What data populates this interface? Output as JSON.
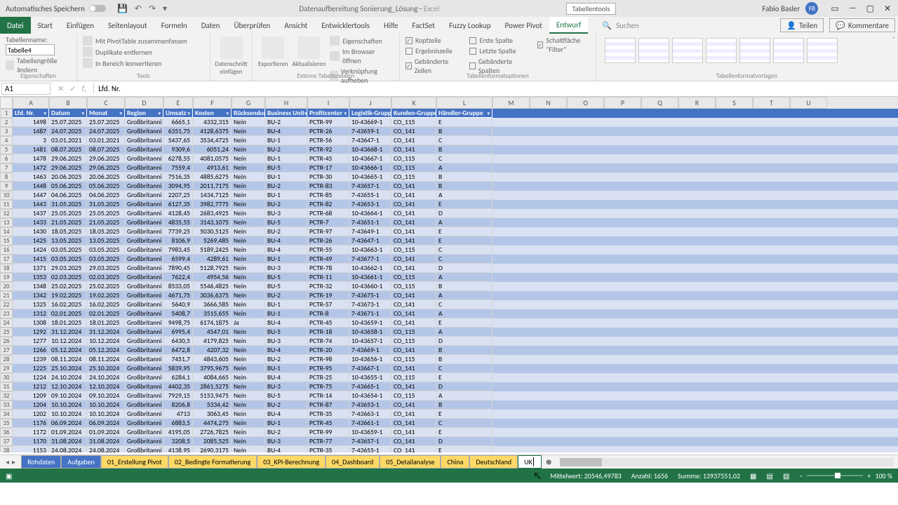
{
  "title": {
    "autosave": "Automatisches Speichern",
    "filename": "Datenaufbereitung Sonierung_Lösung",
    "app": "Excel",
    "tabletools": "Tabellentools",
    "user": "Fabio Basler",
    "initials": "FB"
  },
  "ribbon": {
    "tabs": [
      "Datei",
      "Start",
      "Einfügen",
      "Seitenlayout",
      "Formeln",
      "Daten",
      "Überprüfen",
      "Ansicht",
      "Entwicklertools",
      "Hilfe",
      "FactSet",
      "Fuzzy Lookup",
      "Power Pivot",
      "Entwurf"
    ],
    "search": "Suchen",
    "share": "Teilen",
    "comments": "Kommentare",
    "group_name": {
      "label": "Tabellenname:",
      "value": "Tabelle4",
      "resize": "Tabellengröße ändern",
      "caption": "Eigenschaften"
    },
    "group_tools": {
      "pivot": "Mit PivotTable zusammenfassen",
      "dup": "Duplikate entfernen",
      "range": "In Bereich konvertieren",
      "slicer": "Datenschnitt einfügen",
      "caption": "Tools"
    },
    "group_ext": {
      "export": "Exportieren",
      "refresh": "Aktualisieren",
      "props": "Eigenschaften",
      "browser": "Im Browser öffnen",
      "unlink": "Verknüpfung aufheben",
      "caption": "Externe Tabellendaten"
    },
    "group_opts": {
      "header": "Kopfzeile",
      "total": "Ergebniszeile",
      "banded_rows": "Gebänderte Zeilen",
      "first": "Erste Spalte",
      "last": "Letzte Spalte",
      "banded_cols": "Gebänderte Spalten",
      "filter": "Schaltfläche \"Filter\"",
      "caption": "Tabellenformatoptionen"
    },
    "group_styles": {
      "caption": "Tabellenformatvorlagen"
    }
  },
  "fbar": {
    "namebox": "A1",
    "formula": "Lfd. Nr."
  },
  "columns": [
    "A",
    "B",
    "C",
    "D",
    "E",
    "F",
    "G",
    "H",
    "I",
    "J",
    "K",
    "L",
    "M",
    "N",
    "O",
    "P",
    "Q",
    "R",
    "S",
    "T",
    "U"
  ],
  "headers": [
    "Lfd. Nr.",
    "Datum",
    "Monat",
    "Region",
    "Umsatz",
    "Kosten",
    "Rücksendung",
    "Business Unit",
    "Profitcenter",
    "Logistik-Gruppe",
    "Kunden-Gruppe",
    "Händler-Gruppe"
  ],
  "rows": [
    [
      "1498",
      "25.07.2025",
      "25.07.2025",
      "Großbritanni",
      "6665,1",
      "4332,315",
      "Nein",
      "BU-2",
      "PCTR-99",
      "10-43669-1",
      "CO_115",
      "E"
    ],
    [
      "1487",
      "24.07.2025",
      "24.07.2025",
      "Großbritanni",
      "6351,75",
      "4128,6375",
      "Nein",
      "BU-4",
      "PCTR-26",
      "7-43659-1",
      "CO_141",
      "B"
    ],
    [
      "3",
      "03.01.2021",
      "03.01.2021",
      "Großbritanni",
      "5437,65",
      "3534,4725",
      "Nein",
      "BU-1",
      "PCTR-56",
      "7-43647-1",
      "CO_141",
      "C"
    ],
    [
      "1481",
      "08.07.2025",
      "08.07.2025",
      "Großbritanni",
      "9309,6",
      "6051,24",
      "Nein",
      "BU-2",
      "PCTR-92",
      "10-43668-1",
      "CO_141",
      "B"
    ],
    [
      "1478",
      "29.06.2025",
      "29.06.2025",
      "Großbritanni",
      "6278,55",
      "4081,0575",
      "Nein",
      "BU-1",
      "PCTR-45",
      "10-43667-1",
      "CO_115",
      "C"
    ],
    [
      "1472",
      "29.06.2025",
      "29.06.2025",
      "Großbritanni",
      "7559,4",
      "4913,61",
      "Nein",
      "BU-5",
      "PCTR-17",
      "10-43666-1",
      "CO_115",
      "A"
    ],
    [
      "1463",
      "20.06.2025",
      "20.06.2025",
      "Großbritanni",
      "7516,35",
      "4885,6275",
      "Nein",
      "BU-1",
      "PCTR-30",
      "10-43665-1",
      "CO_115",
      "B"
    ],
    [
      "1448",
      "05.06.2025",
      "05.06.2025",
      "Großbritanni",
      "3094,95",
      "2011,7175",
      "Nein",
      "BU-2",
      "PCTR-83",
      "7-43657-1",
      "CO_141",
      "B"
    ],
    [
      "1447",
      "04.06.2025",
      "04.06.2025",
      "Großbritanni",
      "2207,25",
      "1434,7125",
      "Nein",
      "BU-1",
      "PCTR-85",
      "7-43655-1",
      "CO_141",
      "A"
    ],
    [
      "1443",
      "31.05.2025",
      "31.05.2025",
      "Großbritanni",
      "6127,35",
      "3982,7775",
      "Nein",
      "BU-2",
      "PCTR-82",
      "7-43653-1",
      "CO_141",
      "E"
    ],
    [
      "1437",
      "25.05.2025",
      "25.05.2025",
      "Großbritanni",
      "4128,45",
      "2683,4925",
      "Nein",
      "BU-3",
      "PCTR-68",
      "10-43664-1",
      "CO_141",
      "D"
    ],
    [
      "1433",
      "21.05.2025",
      "21.05.2025",
      "Großbritanni",
      "4835,55",
      "3143,1075",
      "Nein",
      "BU-5",
      "PCTR-7",
      "7-43651-1",
      "CO_141",
      "A"
    ],
    [
      "1430",
      "18.05.2025",
      "18.05.2025",
      "Großbritanni",
      "7739,25",
      "5030,5125",
      "Nein",
      "BU-2",
      "PCTR-97",
      "7-43649-1",
      "CO_141",
      "E"
    ],
    [
      "1425",
      "13.05.2025",
      "13.05.2025",
      "Großbritanni",
      "8106,9",
      "5269,485",
      "Nein",
      "BU-4",
      "PCTR-26",
      "7-43647-1",
      "CO_141",
      "E"
    ],
    [
      "1424",
      "03.05.2025",
      "03.05.2025",
      "Großbritanni",
      "7983,45",
      "5189,2425",
      "Nein",
      "BU-4",
      "PCTR-55",
      "10-43663-1",
      "CO_115",
      "C"
    ],
    [
      "1415",
      "03.05.2025",
      "03.05.2025",
      "Großbritanni",
      "6599,4",
      "4289,61",
      "Nein",
      "BU-1",
      "PCTR-49",
      "7-43677-1",
      "CO_141",
      "C"
    ],
    [
      "1371",
      "29.03.2025",
      "29.03.2025",
      "Großbritanni",
      "7890,45",
      "5128,7925",
      "Nein",
      "BU-3",
      "PCTR-78",
      "10-43662-1",
      "CO_141",
      "D"
    ],
    [
      "1353",
      "02.03.2025",
      "02.03.2025",
      "Großbritanni",
      "7622,4",
      "4954,56",
      "Nein",
      "BU-5",
      "PCTR-11",
      "10-43661-1",
      "CO_115",
      "A"
    ],
    [
      "1348",
      "25.02.2025",
      "25.02.2025",
      "Großbritanni",
      "8533,05",
      "5546,4825",
      "Nein",
      "BU-5",
      "PCTR-32",
      "10-43660-1",
      "CO_115",
      "B"
    ],
    [
      "1342",
      "19.02.2025",
      "19.02.2025",
      "Großbritanni",
      "4671,75",
      "3036,6375",
      "Nein",
      "BU-2",
      "PCTR-19",
      "7-43675-1",
      "CO_141",
      "A"
    ],
    [
      "1325",
      "16.02.2025",
      "16.02.2025",
      "Großbritanni",
      "5640,9",
      "3666,585",
      "Nein",
      "BU-1",
      "PCTR-57",
      "7-43673-1",
      "CO_141",
      "C"
    ],
    [
      "1312",
      "02.01.2025",
      "02.01.2025",
      "Großbritanni",
      "5408,7",
      "3515,655",
      "Nein",
      "BU-1",
      "PCTR-8",
      "7-43671-1",
      "CO_141",
      "A"
    ],
    [
      "1308",
      "18.01.2025",
      "18.01.2025",
      "Großbritanni",
      "9498,75",
      "6174,1875",
      "Ja",
      "BU-4",
      "PCTR-45",
      "10-43659-1",
      "CO_141",
      "E"
    ],
    [
      "1292",
      "31.12.2024",
      "31.12.2024",
      "Großbritanni",
      "6995,4",
      "4547,01",
      "Nein",
      "BU-5",
      "PCTR-18",
      "10-43658-1",
      "CO_115",
      "A"
    ],
    [
      "1277",
      "10.12.2024",
      "10.12.2024",
      "Großbritanni",
      "6430,5",
      "4179,825",
      "Nein",
      "BU-3",
      "PCTR-74",
      "10-43657-1",
      "CO_115",
      "D"
    ],
    [
      "1266",
      "05.12.2024",
      "05.12.2024",
      "Großbritanni",
      "6472,8",
      "4207,32",
      "Nein",
      "BU-4",
      "PCTR-20",
      "7-43669-1",
      "CO_141",
      "B"
    ],
    [
      "1239",
      "08.11.2024",
      "08.11.2024",
      "Großbritanni",
      "7451,7",
      "4843,605",
      "Nein",
      "BU-2",
      "PCTR-98",
      "10-43656-1",
      "CO_115",
      "B"
    ],
    [
      "1225",
      "25.10.2024",
      "25.10.2024",
      "Großbritanni",
      "5839,95",
      "3795,9675",
      "Nein",
      "BU-1",
      "PCTR-95",
      "7-43667-1",
      "CO_141",
      "C"
    ],
    [
      "1224",
      "24.10.2024",
      "24.10.2024",
      "Großbritanni",
      "6284,1",
      "4084,665",
      "Nein",
      "BU-4",
      "PCTR-25",
      "10-43655-1",
      "CO_115",
      "E"
    ],
    [
      "1212",
      "12.10.2024",
      "12.10.2024",
      "Großbritanni",
      "4402,35",
      "2861,5275",
      "Nein",
      "BU-3",
      "PCTR-75",
      "7-43665-1",
      "CO_141",
      "D"
    ],
    [
      "1209",
      "09.10.2024",
      "09.10.2024",
      "Großbritanni",
      "7929,15",
      "5153,9475",
      "Nein",
      "BU-5",
      "PCTR-14",
      "10-43654-1",
      "CO_115",
      "A"
    ],
    [
      "1204",
      "10.10.2024",
      "10.10.2024",
      "Großbritanni",
      "8206,8",
      "5334,42",
      "Nein",
      "BU-2",
      "PCTR-87",
      "7-43653-1",
      "CO_141",
      "B"
    ],
    [
      "1202",
      "10.10.2024",
      "10.10.2024",
      "Großbritanni",
      "4713",
      "3063,45",
      "Nein",
      "BU-4",
      "PCTR-35",
      "7-43663-1",
      "CO_141",
      "E"
    ],
    [
      "1176",
      "06.09.2024",
      "06.09.2024",
      "Großbritanni",
      "6883,5",
      "4474,275",
      "Nein",
      "BU-1",
      "PCTR-45",
      "7-43661-1",
      "CO_141",
      "C"
    ],
    [
      "1172",
      "01.09.2024",
      "01.09.2024",
      "Großbritanni",
      "4195,05",
      "2726,7825",
      "Nein",
      "BU-2",
      "PCTR-99",
      "10-43659-1",
      "CO_141",
      "E"
    ],
    [
      "1170",
      "31.08.2024",
      "31.08.2024",
      "Großbritanni",
      "3208,5",
      "2085,525",
      "Nein",
      "BU-3",
      "PCTR-77",
      "7-43657-1",
      "CO_141",
      "D"
    ],
    [
      "1153",
      "24.08.2024",
      "24.08.2024",
      "Großbritanni",
      "4138,95",
      "2690,3175",
      "Nein",
      "BU-4",
      "PCTR-35",
      "7-43655-1",
      "CO_141",
      "E"
    ]
  ],
  "sheets": {
    "tabs": [
      {
        "label": "Rohdaten",
        "color": "blue"
      },
      {
        "label": "Aufgaben",
        "color": "blue"
      },
      {
        "label": "01_Erstellung Pivot",
        "color": "yellow"
      },
      {
        "label": "02_Bedingte Formatierung",
        "color": "yellow"
      },
      {
        "label": "03_KPI-Berechnung",
        "color": "yellow"
      },
      {
        "label": "04_Dashboard",
        "color": "yellow"
      },
      {
        "label": "05_Detailanalyse",
        "color": "yellow"
      },
      {
        "label": "China",
        "color": "yellow"
      },
      {
        "label": "Deutschland",
        "color": "yellow"
      }
    ],
    "editing": "UK"
  },
  "status": {
    "avg": "Mittelwert: 20546,49783",
    "count": "Anzahl: 1656",
    "sum": "Summe: 13937551,02",
    "zoom": "100 %"
  }
}
